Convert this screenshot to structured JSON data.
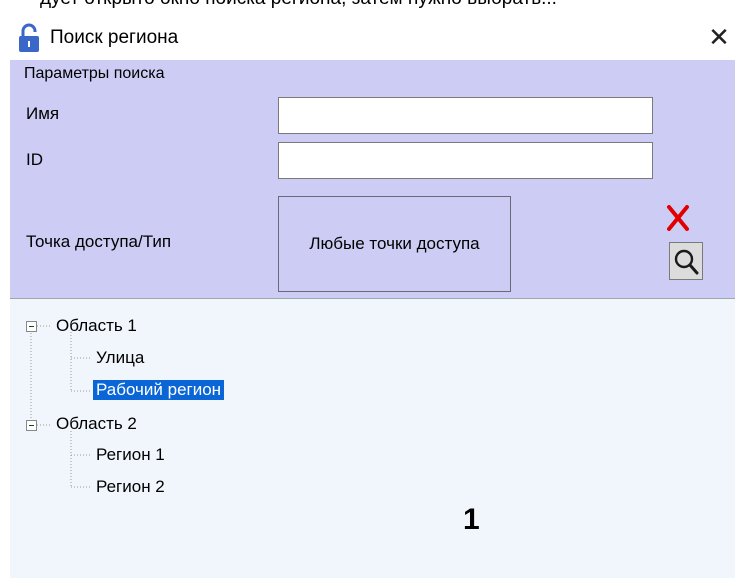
{
  "window": {
    "cut_text": "дует открыто окно поиска региона, затем нужно выбрать...",
    "title": "Поиск региона",
    "lock_icon": "lock-open-icon",
    "close_icon": "close-icon"
  },
  "search_params": {
    "legend": "Параметры поиска",
    "name_label": "Имя",
    "name_value": "",
    "id_label": "ID",
    "id_value": "",
    "access_point_label": "Точка доступа/Тип",
    "access_point_value": "Любые точки доступа",
    "clear_icon": "red-x-icon",
    "search_icon": "magnifier-icon"
  },
  "tree": {
    "nodes": [
      {
        "label": "Область 1",
        "expanded": true
      },
      {
        "label": "Улица"
      },
      {
        "label": "Рабочий регион",
        "selected": true
      },
      {
        "label": "Область 2",
        "expanded": true
      },
      {
        "label": "Регион 1"
      },
      {
        "label": "Регион 2"
      }
    ]
  },
  "annotation": "1",
  "colors": {
    "params_bg": "#ccccf4",
    "tree_bg": "#f0f6fb",
    "selection": "#0a66d6",
    "lock": "#3a67c8",
    "clear_x": "#e00000"
  }
}
